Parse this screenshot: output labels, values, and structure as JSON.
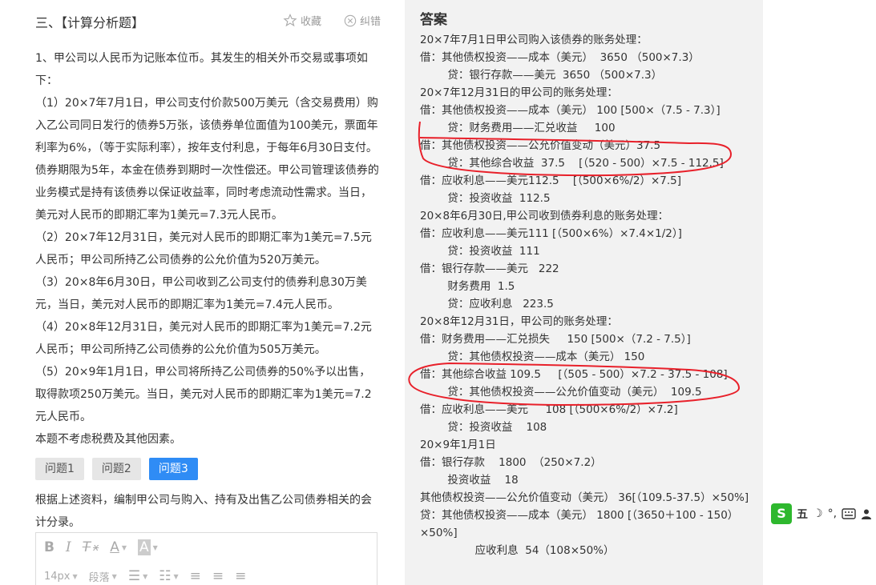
{
  "question": {
    "section_title": "三、【计算分析题】",
    "favorite_label": "收藏",
    "report_label": "纠错",
    "paragraphs": [
      "1、甲公司以人民币为记账本位币。其发生的相关外币交易或事项如下：",
      "（1）20×7年7月1日，甲公司支付价款500万美元（含交易费用）购入乙公司同日发行的债券5万张，该债券单位面值为100美元，票面年利率为6%，（等于实际利率），按年支付利息，于每年6月30日支付。债券期限为5年，本金在债券到期时一次性偿还。甲公司管理该债券的业务模式是持有该债券以保证收益率，同时考虑流动性需求。当日，美元对人民币的即期汇率为1美元=7.3元人民币。",
      "（2）20×7年12月31日，美元对人民币的即期汇率为1美元=7.5元人民币；甲公司所持乙公司债券的公允价值为520万美元。",
      "（3）20×8年6月30日，甲公司收到乙公司支付的债券利息30万美元，当日，美元对人民币的即期汇率为1美元=7.4元人民币。",
      "（4）20×8年12月31日，美元对人民币的即期汇率为1美元=7.2元人民币；甲公司所持乙公司债券的公允价值为505万美元。",
      "（5）20×9年1月1日，甲公司将所持乙公司债券的50%予以出售，取得款项250万美元。当日，美元对人民币的即期汇率为1美元=7.2元人民币。",
      "本题不考虑税费及其他因素。"
    ],
    "tabs": [
      "问题1",
      "问题2",
      "问题3"
    ],
    "active_tab": "问题3",
    "instruction": "根据上述资料，编制甲公司与购入、持有及出售乙公司债券相关的会计分录。"
  },
  "editor": {
    "font_size": "14px",
    "paragraph": "段落"
  },
  "answer": {
    "heading": "答案",
    "lines": [
      "20×7年7月1日甲公司购入该债券的账务处理：",
      "借：其他债权投资——成本（美元）  3650 （500×7.3）",
      "        贷：银行存款——美元  3650 （500×7.3）",
      "20×7年12月31日的甲公司的账务处理：",
      "借：其他债权投资——成本（美元） 100 [500×（7.5 - 7.3）]",
      "        贷：财务费用——汇兑收益     100",
      "借：其他债权投资——公允价值变动（美元）37.5",
      "        贷：其他综合收益  37.5    [（520 - 500）×7.5 - 112.5]",
      "借：应收利息——美元112.5    [（500×6%/2）×7.5]",
      "        贷：投资收益  112.5",
      "20×8年6月30日,甲公司收到债券利息的账务处理：",
      "借：应收利息——美元111 [（500×6%）×7.4×1/2）]",
      "        贷：投资收益  111",
      "借：银行存款——美元   222",
      "        财务费用  1.5",
      "        贷：应收利息   223.5",
      "20×8年12月31日，甲公司的账务处理：",
      "借：财务费用——汇兑损失     150 [500×（7.2 - 7.5）]",
      "        贷：其他债权投资——成本（美元） 150",
      "借：其他综合收益 109.5     [（505 - 500）×7.2 - 37.5 - 108]",
      "        贷：其他债权投资——公允价值变动（美元）  109.5",
      "借：应收利息——美元     108 [（500×6%/2）×7.2]",
      "        贷：投资收益    108",
      "20×9年1月1日",
      "借：银行存款    1800  （250×7.2）",
      "        投资收益    18"
    ],
    "wrap_line_1": "        其他债权投资——公允价值变动（美元） 36[（109.5-37.5）×50%]",
    "wrap_line_2": "        贷：其他债权投资——成本（美元）      1800 [（3650＋100 - 150）×50%]",
    "last_line": "                应收利息  54（108×50%）"
  },
  "ime": {
    "logo": "S",
    "mode": "五",
    "moon": "☽",
    "punct": "°,"
  },
  "colors": {
    "accent": "#2f8cf5",
    "annotation": "#e8202a",
    "answer_bg": "#f2f2f2"
  }
}
